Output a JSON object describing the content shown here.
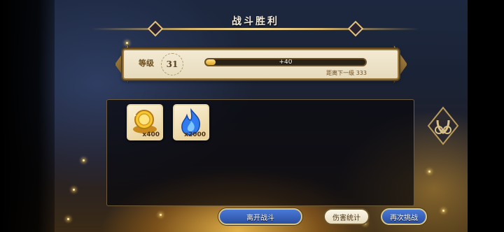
{
  "title": "战斗胜利",
  "level": {
    "label": "等级",
    "value": "31",
    "xp_gain": "+40",
    "next_label": "距离下一级",
    "next_value": "333",
    "progress": 0.06
  },
  "rewards": [
    {
      "icon": "gold-coin-icon",
      "quantity": "x400"
    },
    {
      "icon": "blue-flame-icon",
      "quantity": "x2000"
    }
  ],
  "buttons": {
    "leave": "离开战斗",
    "stats": "伤害统计",
    "retry": "再次挑战"
  },
  "colors": {
    "accent_gold": "#d8b46a",
    "button_blue": "#2a4fa0"
  }
}
